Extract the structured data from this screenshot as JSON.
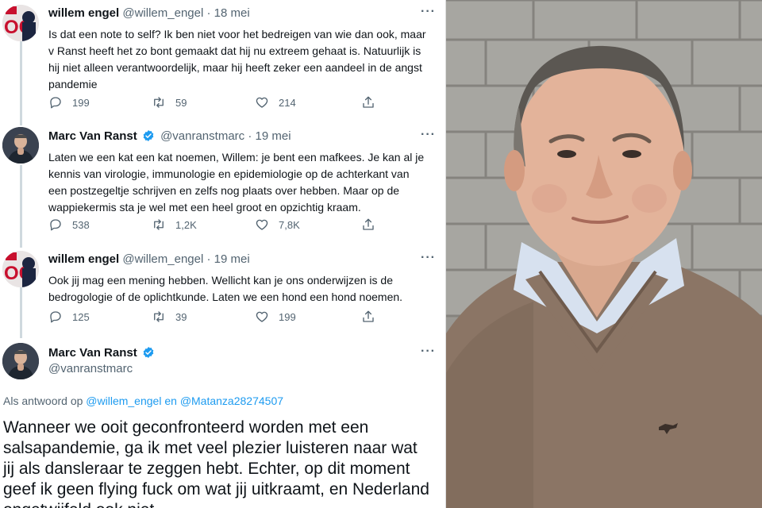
{
  "tweets": [
    {
      "name": "willem engel",
      "handle": "@willem_engel",
      "date": "18 mei",
      "verified": false,
      "text": "Is dat een note to self? Ik ben niet voor het bedreigen van wie dan ook, maar v Ranst heeft het zo bont gemaakt dat hij nu extreem gehaat is. Natuurlijk is hij niet alleen verantwoordelijk, maar hij heeft zeker een aandeel in de angst pandemie",
      "replies": "199",
      "retweets": "59",
      "likes": "214"
    },
    {
      "name": "Marc Van Ranst",
      "handle": "@vanranstmarc",
      "date": "19 mei",
      "verified": true,
      "text": "Laten we een kat een kat noemen, Willem: je bent een mafkees. Je kan al je kennis van virologie, immunologie en epidemiologie op de achterkant van een postzegeltje schrijven en zelfs nog plaats over hebben. Maar op de wappiekermis sta je wel met een heel groot en opzichtig kraam.",
      "replies": "538",
      "retweets": "1,2K",
      "likes": "7,8K"
    },
    {
      "name": "willem engel",
      "handle": "@willem_engel",
      "date": "19 mei",
      "verified": false,
      "text": "Ook jij mag een mening hebben. Wellicht kan je ons onderwijzen is de bedrogologie of de oplichtkunde. Laten we een hond een hond noemen.",
      "replies": "125",
      "retweets": "39",
      "likes": "199"
    }
  ],
  "main_tweet": {
    "name": "Marc Van Ranst",
    "handle": "@vanranstmarc",
    "verified": true,
    "reply_prefix": "Als antwoord op",
    "reply_user_1": "@willem_engel",
    "reply_joiner": "en",
    "reply_user_2": "@Matanza28274507",
    "text": "Wanneer we ooit geconfronteerd worden met een salsapandemie, ga ik met veel plezier luisteren naar wat jij als dansleraar te zeggen hebt. Echter, op dit moment geef ik geen flying fuck om wat jij uitkraamt, en Nederland ongetwijfeld ook niet."
  },
  "ui": {
    "more_label": "···",
    "separator": "·"
  },
  "icons": {
    "reply": "reply-icon",
    "retweet": "retweet-icon",
    "like": "like-icon",
    "share": "share-icon",
    "verified": "verified-badge-icon",
    "more": "more-icon"
  },
  "colors": {
    "verified": "#1d9bf0",
    "link": "#1d9bf0",
    "muted": "#536471",
    "rail": "#cfd9de"
  }
}
